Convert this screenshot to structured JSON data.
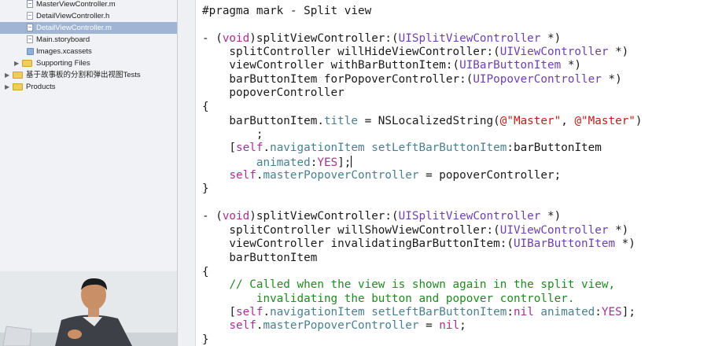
{
  "navigator": {
    "items": [
      {
        "label": "MasterViewController.m",
        "kind": "file-m",
        "selected": false
      },
      {
        "label": "DetailViewController.h",
        "kind": "file-h",
        "selected": false
      },
      {
        "label": "DetailViewController.m",
        "kind": "file-m",
        "selected": true
      },
      {
        "label": "Main.storyboard",
        "kind": "storyboard",
        "selected": false
      },
      {
        "label": "Images.xcassets",
        "kind": "asset",
        "selected": false
      },
      {
        "label": "Supporting Files",
        "kind": "folder",
        "selected": false
      },
      {
        "label": "基于故事板的分割和弹出视图Tests",
        "kind": "folder",
        "selected": false
      },
      {
        "label": "Products",
        "kind": "folder",
        "selected": false
      }
    ],
    "disclosure_glyph": "▶"
  },
  "editor": {
    "lines": [
      [
        {
          "t": "#pragma mark - Split view",
          "c": ""
        }
      ],
      [
        {
          "t": "- (",
          "c": ""
        },
        {
          "t": "void",
          "c": "kw"
        },
        {
          "t": ")splitViewController:(",
          "c": ""
        },
        {
          "t": "UISplitViewController",
          "c": "ty"
        },
        {
          "t": " *)",
          "c": ""
        }
      ],
      [
        {
          "t": "    splitController willHideViewController:(",
          "c": ""
        },
        {
          "t": "UIViewController",
          "c": "ty"
        },
        {
          "t": " *)",
          "c": ""
        }
      ],
      [
        {
          "t": "    viewController withBarButtonItem:(",
          "c": ""
        },
        {
          "t": "UIBarButtonItem",
          "c": "ty"
        },
        {
          "t": " *)",
          "c": ""
        }
      ],
      [
        {
          "t": "    barButtonItem forPopoverController:(",
          "c": ""
        },
        {
          "t": "UIPopoverController",
          "c": "ty"
        },
        {
          "t": " *)",
          "c": ""
        }
      ],
      [
        {
          "t": "    popoverController",
          "c": ""
        }
      ],
      [
        {
          "t": "{",
          "c": ""
        }
      ],
      [
        {
          "t": "    barButtonItem.",
          "c": ""
        },
        {
          "t": "title",
          "c": "pr"
        },
        {
          "t": " = NSLocalizedString(",
          "c": ""
        },
        {
          "t": "@\"Master\"",
          "c": "st"
        },
        {
          "t": ", ",
          "c": ""
        },
        {
          "t": "@\"Master\"",
          "c": "st"
        },
        {
          "t": ")",
          "c": ""
        }
      ],
      [
        {
          "t": "        ;",
          "c": ""
        }
      ],
      [
        {
          "t": "    [",
          "c": ""
        },
        {
          "t": "self",
          "c": "kw"
        },
        {
          "t": ".",
          "c": ""
        },
        {
          "t": "navigationItem",
          "c": "pr"
        },
        {
          "t": " ",
          "c": ""
        },
        {
          "t": "setLeftBarButtonItem",
          "c": "pr"
        },
        {
          "t": ":barButtonItem",
          "c": ""
        }
      ],
      [
        {
          "t": "        ",
          "c": ""
        },
        {
          "t": "animated",
          "c": "pr"
        },
        {
          "t": ":",
          "c": ""
        },
        {
          "t": "YES",
          "c": "kw"
        },
        {
          "t": "];",
          "c": ""
        },
        {
          "t": "|cursor|",
          "c": "cursor"
        }
      ],
      [
        {
          "t": "    ",
          "c": ""
        },
        {
          "t": "self",
          "c": "kw"
        },
        {
          "t": ".",
          "c": ""
        },
        {
          "t": "masterPopoverController",
          "c": "pr"
        },
        {
          "t": " = popoverController;",
          "c": ""
        }
      ],
      [
        {
          "t": "}",
          "c": ""
        }
      ],
      [
        {
          "t": "- (",
          "c": ""
        },
        {
          "t": "void",
          "c": "kw"
        },
        {
          "t": ")splitViewController:(",
          "c": ""
        },
        {
          "t": "UISplitViewController",
          "c": "ty"
        },
        {
          "t": " *)",
          "c": ""
        }
      ],
      [
        {
          "t": "    splitController willShowViewController:(",
          "c": ""
        },
        {
          "t": "UIViewController",
          "c": "ty"
        },
        {
          "t": " *)",
          "c": ""
        }
      ],
      [
        {
          "t": "    viewController invalidatingBarButtonItem:(",
          "c": ""
        },
        {
          "t": "UIBarButtonItem",
          "c": "ty"
        },
        {
          "t": " *)",
          "c": ""
        }
      ],
      [
        {
          "t": "    barButtonItem",
          "c": ""
        }
      ],
      [
        {
          "t": "{",
          "c": ""
        }
      ],
      [
        {
          "t": "    ",
          "c": ""
        },
        {
          "t": "// Called when the view is shown again in the split view,",
          "c": "cm"
        }
      ],
      [
        {
          "t": "        ",
          "c": ""
        },
        {
          "t": "invalidating the button and popover controller.",
          "c": "cm"
        }
      ],
      [
        {
          "t": "    [",
          "c": ""
        },
        {
          "t": "self",
          "c": "kw"
        },
        {
          "t": ".",
          "c": ""
        },
        {
          "t": "navigationItem",
          "c": "pr"
        },
        {
          "t": " ",
          "c": ""
        },
        {
          "t": "setLeftBarButtonItem",
          "c": "pr"
        },
        {
          "t": ":",
          "c": ""
        },
        {
          "t": "nil",
          "c": "kw"
        },
        {
          "t": " ",
          "c": ""
        },
        {
          "t": "animated",
          "c": "pr"
        },
        {
          "t": ":",
          "c": ""
        },
        {
          "t": "YES",
          "c": "kw"
        },
        {
          "t": "];",
          "c": ""
        }
      ],
      [
        {
          "t": "    ",
          "c": ""
        },
        {
          "t": "self",
          "c": "kw"
        },
        {
          "t": ".",
          "c": ""
        },
        {
          "t": "masterPopoverController",
          "c": "pr"
        },
        {
          "t": " = ",
          "c": ""
        },
        {
          "t": "nil",
          "c": "kw"
        },
        {
          "t": ";",
          "c": ""
        }
      ],
      [
        {
          "t": "}",
          "c": ""
        }
      ]
    ]
  },
  "colors": {
    "keyword": "#aa2f90",
    "type": "#6f3fb0",
    "property": "#4a7f8f",
    "string": "#c41a16",
    "comment": "#1f8a1f",
    "selection": "#9fb5d3"
  }
}
